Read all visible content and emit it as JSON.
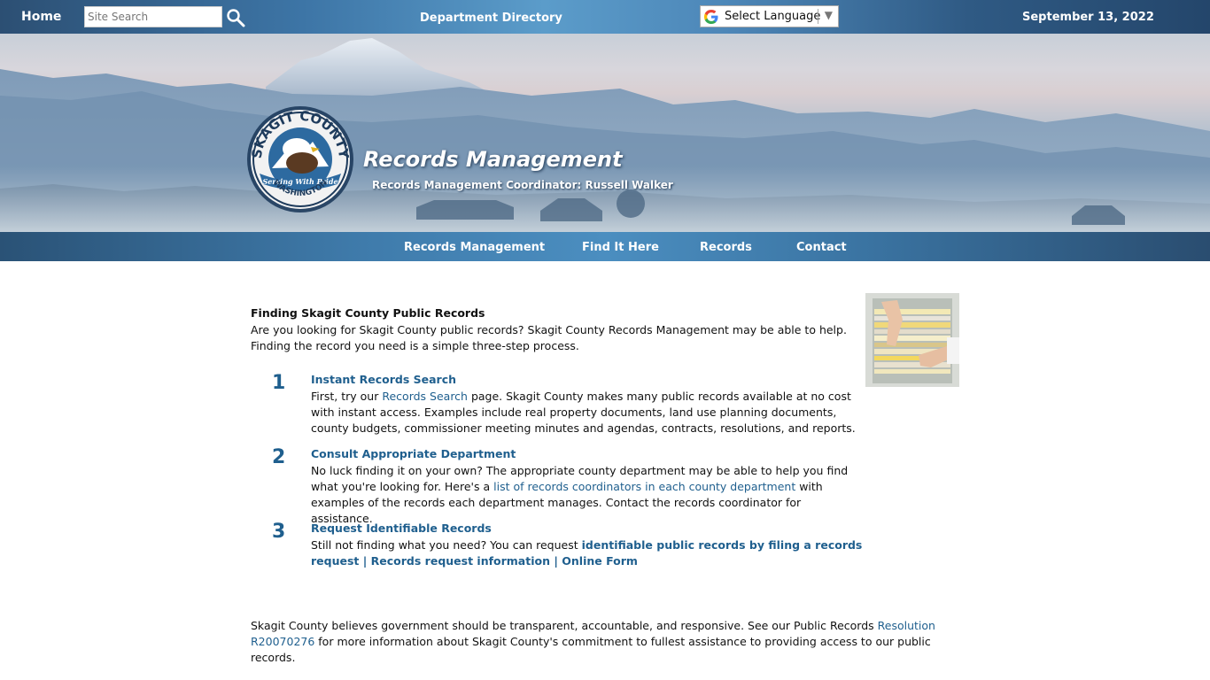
{
  "topbar": {
    "home_label": "Home",
    "search_placeholder": "Site Search",
    "department_directory": "Department Directory",
    "language_label": "Select Language",
    "language_arrow": "▼",
    "date": "September 13, 2022"
  },
  "banner": {
    "title": "Records Management",
    "subtitle": "Records Management Coordinator: Russell Walker",
    "seal": {
      "top_text": "SKAGIT COUNTY",
      "ribbon_text": "Serving With Pride",
      "bottom_text": "WASHINGTON"
    }
  },
  "nav": {
    "items": [
      {
        "label": "Records Management"
      },
      {
        "label": "Find It Here"
      },
      {
        "label": "Records"
      },
      {
        "label": "Contact"
      }
    ]
  },
  "intro": {
    "title": "Finding Skagit County Public Records",
    "body": "Are you looking for Skagit County public records? Skagit County Records Management may be able to help. Finding the record you need is a simple three-step process."
  },
  "steps": [
    {
      "number": "1",
      "title": "Instant Records Search",
      "before": "First, try our ",
      "link": "Records Search",
      "after": " page. Skagit County makes many public records available at no cost with instant access. Examples include real property documents, land use planning documents, county budgets, commissioner meeting minutes and agendas, contracts, resolutions, and reports."
    },
    {
      "number": "2",
      "title": "Consult Appropriate Department",
      "before": "No luck finding it on your own? The appropriate county department may be able to help you find what you're looking for. Here's a ",
      "link": "list of records coordinators in each county department",
      "after": " with examples of the records each department manages. Contact the records coordinator for assistance."
    },
    {
      "number": "3",
      "title": "Request Identifiable Records",
      "before": "Still not finding what you need? You can request ",
      "link": "identifiable public records by filing a records request",
      "sep1": " | ",
      "link2": "Records request information",
      "sep2": " | ",
      "link3": "Online Form"
    }
  ],
  "footer": {
    "before": "Skagit County believes government should be transparent, accountable, and responsive. See our Public Records ",
    "link": "Resolution R20070276",
    "after": " for more information about Skagit County's commitment to fullest assistance to providing access to our public records."
  },
  "colors": {
    "link": "#1f5f8e",
    "topbar": "#3d75a6"
  }
}
